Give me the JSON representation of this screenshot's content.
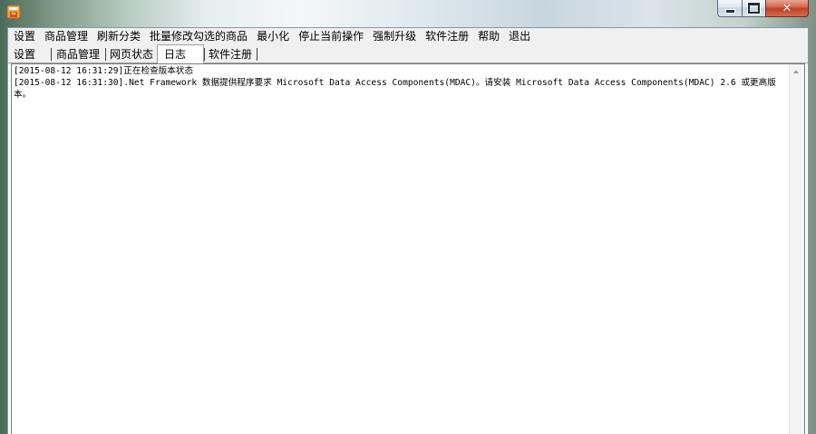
{
  "window": {
    "app_icon": "app-icon"
  },
  "menu": {
    "items": [
      {
        "label": "设置"
      },
      {
        "label": "商品管理"
      },
      {
        "label": "刷新分类"
      },
      {
        "label": "批量修改勾选的商品"
      },
      {
        "label": "最小化"
      },
      {
        "label": "停止当前操作"
      },
      {
        "label": "强制升级"
      },
      {
        "label": "软件注册"
      },
      {
        "label": "帮助"
      },
      {
        "label": "退出"
      }
    ]
  },
  "tabs": {
    "active": "日志",
    "items": [
      {
        "label": "设置"
      },
      {
        "label": "商品管理"
      },
      {
        "label": "网页状态"
      },
      {
        "label": "日志"
      },
      {
        "label": "软件注册"
      }
    ]
  },
  "log": {
    "lines": [
      "[2015-08-12 16:31:29]正在检查版本状态",
      "[2015-08-12 16:31:30].Net Framework 数据提供程序要求 Microsoft Data Access Components(MDAC)。请安装 Microsoft Data Access Components(MDAC) 2.6 或更高版本。"
    ]
  },
  "icons": {
    "minimize": "minimize-icon",
    "maximize": "maximize-icon",
    "close": "close-icon",
    "scroll_up": "scroll-up-arrow-icon"
  }
}
